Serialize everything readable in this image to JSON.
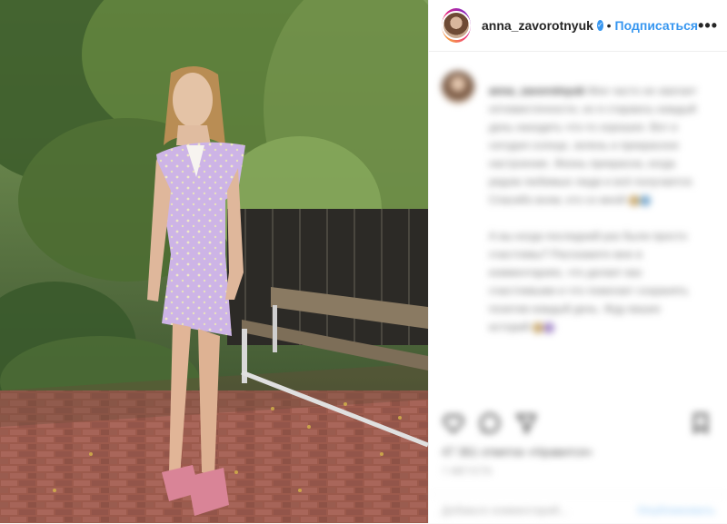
{
  "header": {
    "username": "anna_zavorotnyuk",
    "verified_mark": "✓",
    "separator": "•",
    "follow_label": "Подписаться",
    "more_label": "•••"
  },
  "caption": {
    "username": "anna_zavorotnyuk",
    "paragraph1": "Мне часто не хватает оптимистичности, но я стараюсь каждый день находить что-то хорошее. Вот и сегодня солнце, зелень и прекрасное настроение. Жизнь прекрасна, когда рядом любимые люди и всё получается. Спасибо всем, кто со мной",
    "paragraph2": "А вы когда последний раз были просто счастливы? Расскажите мне в комментариях, что делает вас счастливыми и что помогает сохранять позитив каждый день. Жду ваших историй"
  },
  "likes_text": "47 361 отметок «Нравится»",
  "date_text": "7 АВГУСТА",
  "comment_placeholder": "Добавьте комментарий...",
  "post_label": "Опубликовать",
  "colors": {
    "accent": "#3897f0",
    "text": "#262626"
  }
}
